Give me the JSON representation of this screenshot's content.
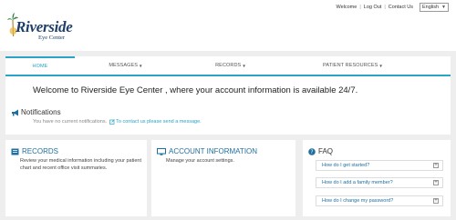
{
  "header": {
    "brand": "Riverside",
    "brand_sub": "Eye Center",
    "links": [
      "Welcome",
      "Log Out",
      "Contact Us"
    ],
    "language": "English"
  },
  "nav": {
    "tabs": [
      {
        "label": "HOME",
        "active": true
      },
      {
        "label": "MESSAGES",
        "active": false
      },
      {
        "label": "RECORDS",
        "active": false
      },
      {
        "label": "PATIENT RESOURCES",
        "active": false
      }
    ]
  },
  "welcome": {
    "message": "Welcome to Riverside Eye Center , where your account information is available 24/7."
  },
  "notifications": {
    "title": "Notifications",
    "empty_text": "You have no current notifications.",
    "contact_link": "To contact us please send a message."
  },
  "records": {
    "title": "RECORDS",
    "description": "Review your medical information including your patient chart and recent office visit summaries."
  },
  "account": {
    "title": "ACCOUNT INFORMATION",
    "description": "Manage your account settings."
  },
  "faq": {
    "title": "FAQ",
    "items": [
      "How do I get started?",
      "How do I add a family member?",
      "How do I change my password?"
    ]
  },
  "colors": {
    "accent": "#29a4c7",
    "link": "#1e6fa0",
    "background": "#eeeeee"
  }
}
